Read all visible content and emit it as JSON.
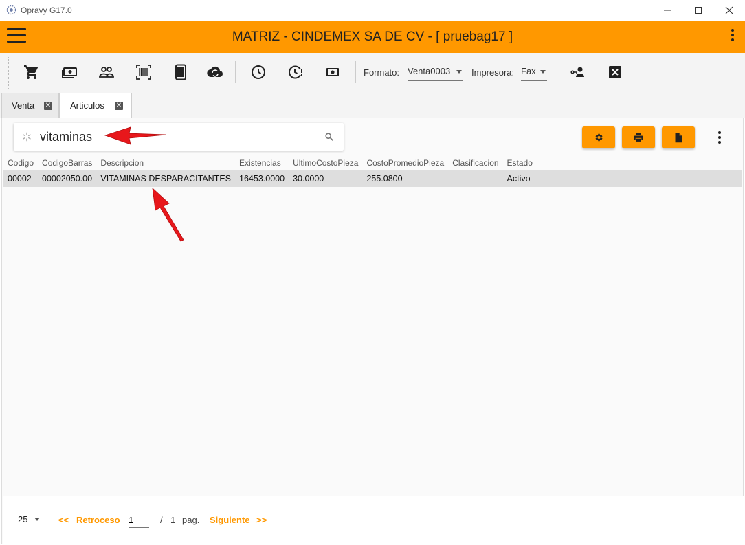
{
  "window": {
    "title": "Opravy G17.0",
    "minimize": "—",
    "maximize": "☐",
    "close": "✕"
  },
  "appbar": {
    "title": "MATRIZ - CINDEMEX SA DE CV - [ pruebag17 ]"
  },
  "toolbar": {
    "icons": [
      "cart-icon",
      "cash-icon",
      "people-icon",
      "barcode-icon",
      "tablet-icon",
      "cloud-sync-icon",
      "clock-icon",
      "clock-alert-icon",
      "money-icon",
      "user-key-icon",
      "close-box-icon"
    ],
    "formato_label": "Formato:",
    "formato_value": "Venta0003",
    "impresora_label": "Impresora:",
    "impresora_value": "Fax"
  },
  "tabs": [
    {
      "label": "Venta",
      "close": "✕"
    },
    {
      "label": "Articulos",
      "close": "✕"
    }
  ],
  "search": {
    "value": "vitaminas"
  },
  "table": {
    "columns": [
      "Codigo",
      "CodigoBarras",
      "Descripcion",
      "Existencias",
      "UltimoCostoPieza",
      "CostoPromedioPieza",
      "Clasificacion",
      "Estado"
    ],
    "rows": [
      [
        "00002",
        "00002050.00",
        "VITAMINAS DESPARACITANTES",
        "16453.0000",
        "30.0000",
        "255.0800",
        "",
        "Activo"
      ]
    ]
  },
  "footer": {
    "page_size": "25",
    "prev": "<<",
    "prev_label": "Retroceso",
    "page": "1",
    "of": "/",
    "total_pages": "1",
    "pag_label": "pag.",
    "next_label": "Siguiente",
    "next": ">>"
  },
  "colors": {
    "accent": "#ff9800",
    "annotation_arrow": "#e8171b"
  }
}
